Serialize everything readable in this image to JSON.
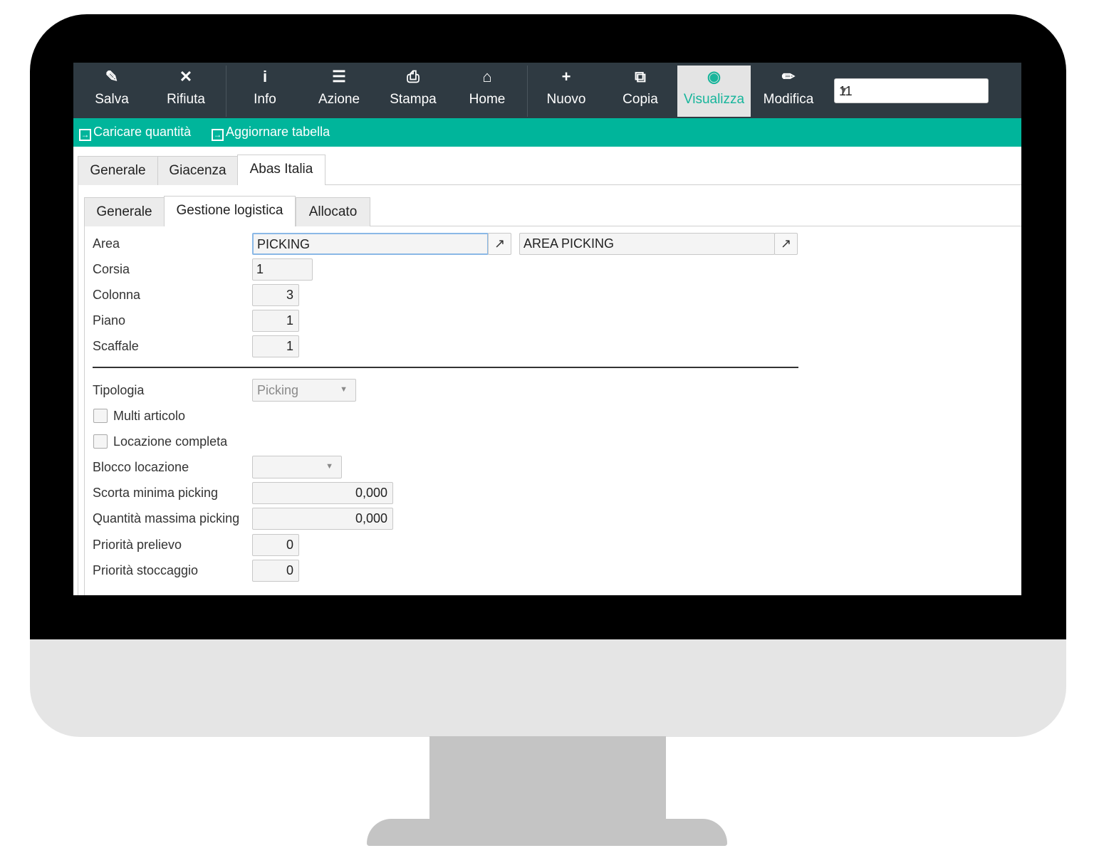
{
  "toolbar": {
    "buttons": [
      {
        "label": "Salva",
        "icon": "save-icon"
      },
      {
        "label": "Rifiuta",
        "icon": "close-icon"
      },
      {
        "label": "Info",
        "icon": "info-icon"
      },
      {
        "label": "Azione",
        "icon": "menu-icon"
      },
      {
        "label": "Stampa",
        "icon": "print-icon"
      },
      {
        "label": "Home",
        "icon": "home-icon"
      },
      {
        "label": "Nuovo",
        "icon": "plus-icon"
      },
      {
        "label": "Copia",
        "icon": "copy-icon"
      },
      {
        "label": "Visualizza",
        "icon": "eye-icon",
        "active": true
      },
      {
        "label": "Modifica",
        "icon": "pencil-icon"
      }
    ],
    "selector_value": "11"
  },
  "actions": {
    "load_quantity": "Caricare quantità",
    "update_table": "Aggiornare tabella"
  },
  "tabs_main": [
    "Generale",
    "Giacenza",
    "Abas Italia"
  ],
  "tabs_main_selected": "Abas Italia",
  "tabs_sub": [
    "Generale",
    "Gestione logistica",
    "Allocato"
  ],
  "tabs_sub_selected": "Gestione logistica",
  "form": {
    "area": {
      "label": "Area",
      "code": "PICKING",
      "description": "AREA PICKING"
    },
    "corsia": {
      "label": "Corsia",
      "value": "1"
    },
    "colonna": {
      "label": "Colonna",
      "value": "3"
    },
    "piano": {
      "label": "Piano",
      "value": "1"
    },
    "scaffale": {
      "label": "Scaffale",
      "value": "1"
    },
    "tipologia": {
      "label": "Tipologia",
      "value": "Picking"
    },
    "multi_articolo": {
      "label": "Multi articolo",
      "checked": false
    },
    "locazione_completa": {
      "label": "Locazione completa",
      "checked": false
    },
    "blocco_locazione": {
      "label": "Blocco locazione",
      "value": ""
    },
    "scorta_minima": {
      "label": "Scorta minima picking",
      "value": "0,000"
    },
    "quantita_massima": {
      "label": "Quantità massima picking",
      "value": "0,000"
    },
    "priorita_prelievo": {
      "label": "Priorità prelievo",
      "value": "0"
    },
    "priorita_stoccaggio": {
      "label": "Priorità stoccaggio",
      "value": "0"
    }
  },
  "colors": {
    "accent": "#00b59b",
    "toolbar_bg": "#2f3a42",
    "active_text": "#17b59b"
  }
}
